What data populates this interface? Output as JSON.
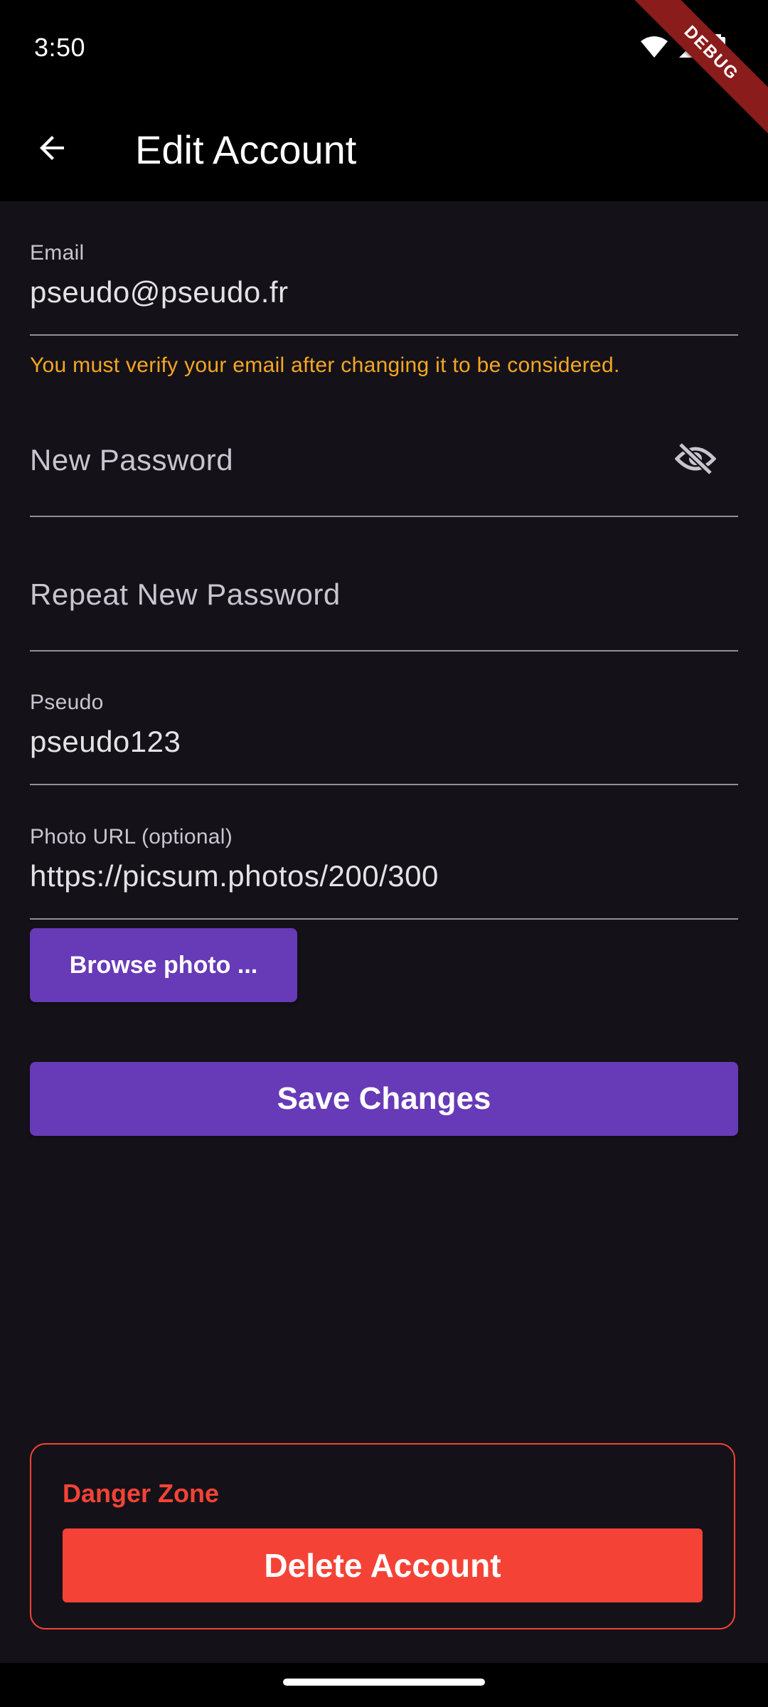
{
  "status_bar": {
    "time": "3:50",
    "icons": [
      "wifi-icon",
      "signal-icon",
      "battery-icon"
    ]
  },
  "debug_banner": "DEBUG",
  "app_bar": {
    "title": "Edit Account",
    "back_icon": "arrow-back-icon"
  },
  "form": {
    "email": {
      "label": "Email",
      "value": "pseudo@pseudo.fr",
      "helper": "You must verify your email after changing it to be considered."
    },
    "new_password": {
      "placeholder": "New Password",
      "toggle_icon": "visibility-off-icon"
    },
    "repeat_password": {
      "placeholder": "Repeat New Password"
    },
    "pseudo": {
      "label": "Pseudo",
      "value": "pseudo123"
    },
    "photo_url": {
      "label": "Photo URL (optional)",
      "value": "https://picsum.photos/200/300"
    },
    "browse_label": "Browse photo ...",
    "save_label": "Save Changes"
  },
  "danger_zone": {
    "title": "Danger Zone",
    "delete_label": "Delete Account"
  },
  "colors": {
    "background": "#141218",
    "primary_button": "#673ab7",
    "danger": "#f44336",
    "warning_text": "#f5a623",
    "underline": "#938f99"
  }
}
